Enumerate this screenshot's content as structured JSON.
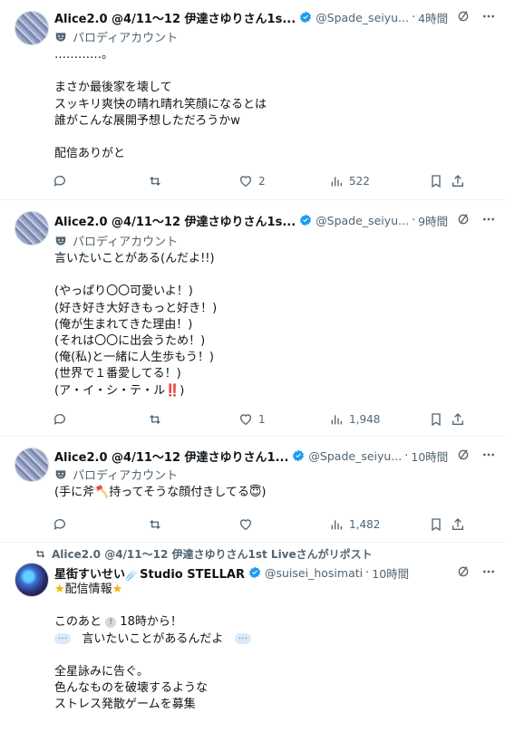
{
  "tweets": [
    {
      "name": "Alice2.0 @4/11～12 伊達さゆりさん1s...",
      "handle": "@Spade_seiyu...",
      "time": "4時間",
      "label": "パロディアカウント",
      "lines": [
        "…………。",
        "",
        "まさか最後家を壊して",
        "スッキリ爽快の晴れ晴れ笑顔になるとは",
        "誰がこんな展開予想しただろうかw",
        "",
        "配信ありがと"
      ],
      "counts": {
        "reply": "",
        "repost": "",
        "like": "2",
        "views": "522"
      }
    },
    {
      "name": "Alice2.0 @4/11～12 伊達さゆりさん1s...",
      "handle": "@Spade_seiyu...",
      "time": "9時間",
      "label": "パロディアカウント",
      "lines": [
        "言いたいことがある(んだよ!!)",
        "",
        "(やっぱり〇〇可愛いよ！)",
        "(好き好き大好きもっと好き！)",
        "(俺が生まれてきた理由！)",
        "(それは〇〇に出会うため！)",
        "(俺(私)と一緒に人生歩もう！)",
        "(世界で１番愛してる！)",
        "(ア・イ・シ・テ・ル‼️)"
      ],
      "counts": {
        "reply": "",
        "repost": "",
        "like": "1",
        "views": "1,948"
      }
    },
    {
      "name": "Alice2.0 @4/11～12 伊達さゆりさん1...",
      "handle": "@Spade_seiyu...",
      "time": "10時間",
      "label": "パロディアカウント",
      "lines": [
        "(手に斧🪓持ってそうな顔付きしてる😇)"
      ],
      "counts": {
        "reply": "",
        "repost": "",
        "like": "",
        "views": "1,482"
      }
    }
  ],
  "repost_tweet": {
    "reposted_by": "Alice2.0 @4/11～12 伊達さゆりさん1st Liveさんがリポスト",
    "name": "星街すいせい☄️Studio STELLAR",
    "handle": "@suisei_hosimati",
    "time": "10時間",
    "info_title": "配信情報",
    "line_after": "このあと",
    "line_after_time": "18時から！",
    "line_quote": "言いたいことがあるんだよ",
    "lines_tail": [
      "全星詠みに告ぐ。",
      "色んなものを破壊するような",
      "ストレス発散ゲームを募集"
    ]
  },
  "colors": {
    "verified": "#1d9bf0",
    "muted": "#536471",
    "text": "#0f1419",
    "divider": "#eff3f4"
  }
}
